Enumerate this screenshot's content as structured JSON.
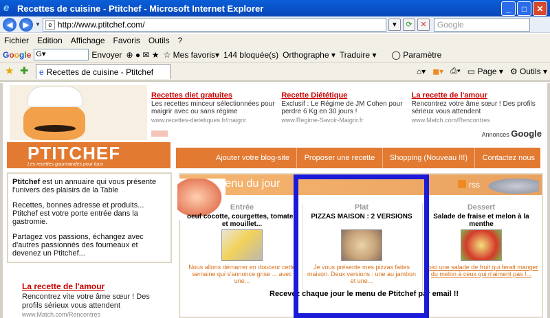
{
  "window": {
    "title": "Recettes de cuisine - Ptitchef - Microsoft Internet Explorer"
  },
  "address": {
    "url": "http://www.ptitchef.com/",
    "search_placeholder": "Google"
  },
  "menu": [
    "Fichier",
    "Edition",
    "Affichage",
    "Favoris",
    "Outils",
    "?"
  ],
  "google_toolbar": {
    "logo": "Google",
    "send": "Envoyer",
    "favorites": "Mes favoris",
    "blocked": "144 bloquée(s)",
    "spelling": "Orthographe",
    "translate": "Traduire",
    "settings": "Paramètre"
  },
  "tab": {
    "title": "Recettes de cuisine - Ptitchef",
    "page": "Page",
    "tools": "Outils"
  },
  "ads": [
    {
      "title": "Recettes diet gratuites",
      "text": "Les recettes minceur sélectionnées pour maigrir avec ou sans régime",
      "url": "www.recettes-dietetiques.fr/maigrir"
    },
    {
      "title": "Recette Diététique",
      "text": "Exclusif : Le Régime de JM Cohen pour perdre 6 Kg en 30 jours !",
      "url": "www.Regime-Savoir-Maigrir.fr"
    },
    {
      "title": "La recette de l'amour",
      "text": "Rencontrez votre âme sœur ! Des profils sérieux vous attendent",
      "url": "www.Match.com/Rencontres"
    }
  ],
  "annonces": {
    "label": "Annonces",
    "brand": "Google"
  },
  "brand": {
    "name_a": "PTIT",
    "name_b": "CHEF",
    "tagline": "Les recettes gourmandes pour tous"
  },
  "nav": [
    "Ajouter votre blog-site",
    "Proposer une recette",
    "Shopping (Nouveau !!!)",
    "Contactez nous"
  ],
  "left": {
    "p1_bold": "Ptitchef",
    "p1": " est un annuaire qui vous présente l'univers des plaisirs de la Table",
    "p2": "Recettes, bonnes adresse et produits... Ptitchef est votre porte entrée dans la gastromie.",
    "p3": "Partagez vos passions, échangez avec d'autres passionnés des fourneaux et devenez un Ptitchef..."
  },
  "left_ad": {
    "title": "La recette de l'amour",
    "text": "Rencontrez vite votre âme sœur ! Des profils sérieux vous attendent",
    "url": "www.Match.com/Rencontres"
  },
  "menu_du_jour": {
    "title": "Menu du jour",
    "rss": "rss",
    "entree": {
      "label": "Entrée",
      "dish": "oeuf cocotte, courgettes, tomates et mouillet...",
      "desc": "Nous allons démarrer en douceur cette semaine qui s'annonce grise ... avec une..."
    },
    "plat": {
      "label": "Plat",
      "dish": "PIZZAS MAISON : 2 VERSIONS",
      "desc": "Je vous présente mes pizzas faites maison. Deux versions : une au jambon et une..."
    },
    "dessert": {
      "label": "Dessert",
      "dish": "Salade de fraise et melon à la menthe",
      "desc": "Voici une salade de fruit qui ferait manger du melon à ceux qui n'aiment pas !..."
    },
    "footer": "Recevez chaque jour le menu de Ptitchef par email !!"
  }
}
